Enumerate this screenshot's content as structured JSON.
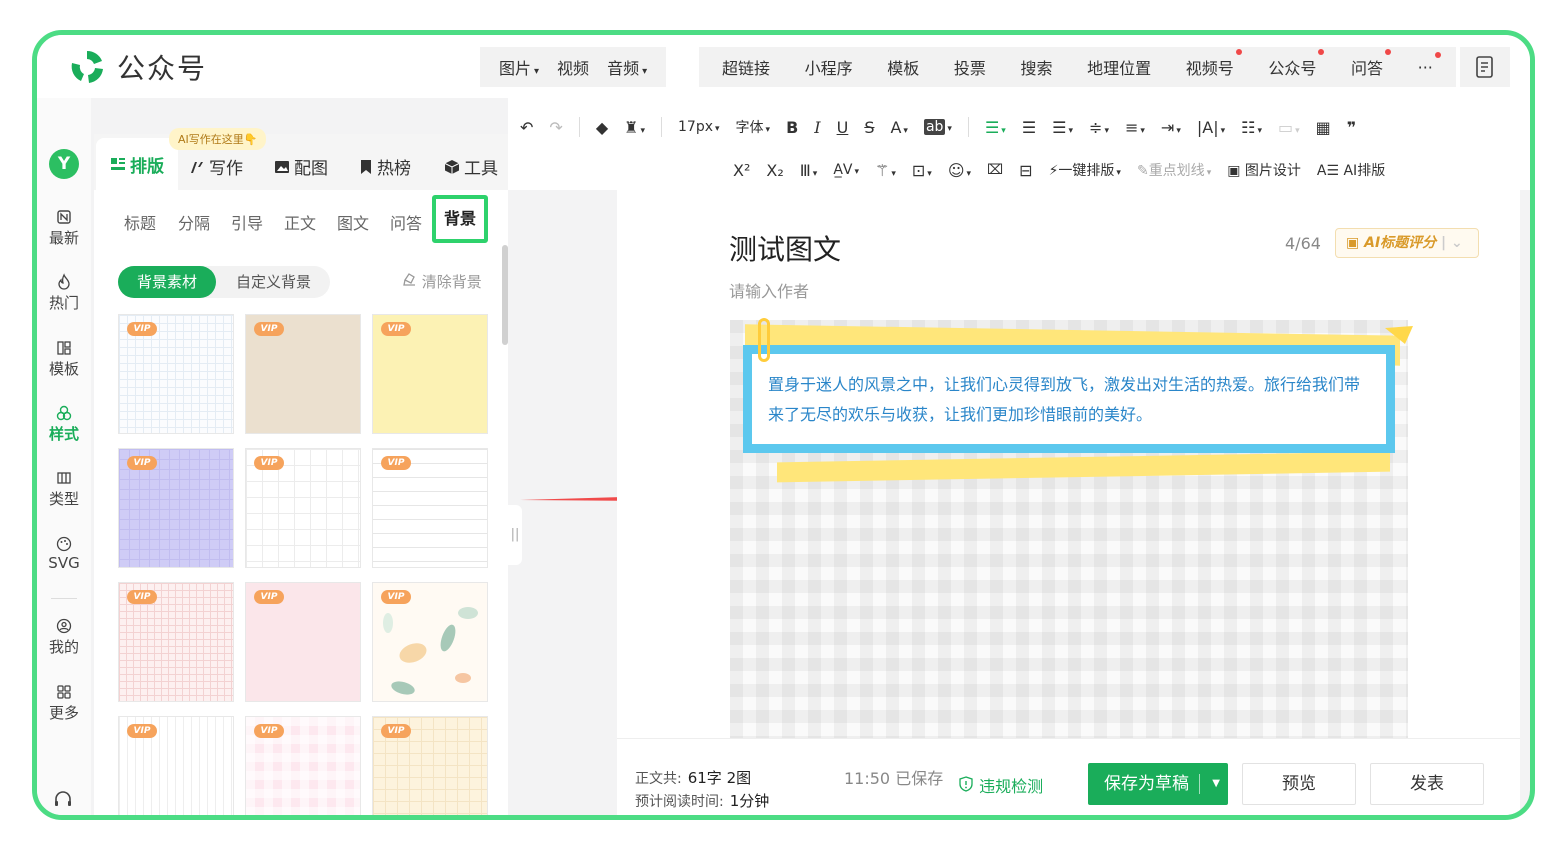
{
  "header": {
    "brand": "公众号",
    "media_items": [
      {
        "label": "图片",
        "caret": "▾"
      },
      {
        "label": "视频",
        "caret": ""
      },
      {
        "label": "音频",
        "caret": "▾"
      }
    ],
    "insert_items": [
      {
        "label": "超链接"
      },
      {
        "label": "小程序"
      },
      {
        "label": "模板"
      },
      {
        "label": "投票"
      },
      {
        "label": "搜索"
      },
      {
        "label": "地理位置"
      },
      {
        "label": "视频号"
      },
      {
        "label": "公众号"
      },
      {
        "label": "问答"
      },
      {
        "label": "···"
      }
    ]
  },
  "leftnav": {
    "logo": "Y",
    "items": [
      {
        "label": "最新"
      },
      {
        "label": "热门"
      },
      {
        "label": "模板"
      },
      {
        "label": "样式"
      },
      {
        "label": "类型"
      },
      {
        "label": "SVG"
      },
      {
        "label": "我的"
      },
      {
        "label": "更多"
      }
    ]
  },
  "panel": {
    "ai_badge": "AI写作在这里👇",
    "tabs": [
      {
        "label": "排版"
      },
      {
        "label": "写作"
      },
      {
        "label": "配图"
      },
      {
        "label": "热榜"
      },
      {
        "label": "工具"
      }
    ],
    "subtabs": [
      {
        "label": "标题"
      },
      {
        "label": "分隔"
      },
      {
        "label": "引导"
      },
      {
        "label": "正文"
      },
      {
        "label": "图文"
      },
      {
        "label": "问答"
      },
      {
        "label": "背景"
      }
    ],
    "segment_on": "背景素材",
    "segment_off": "自定义背景",
    "clear_bg": "清除背景",
    "vip_label": "VIP"
  },
  "toolbar": {
    "row1": {
      "font_size": "17px",
      "font_family": "字体",
      "bold": "B",
      "italic": "I",
      "underline": "U",
      "strike": "S",
      "color": "A",
      "highlight": "ab"
    },
    "row2": {
      "sup": "X²",
      "sub": "X₂",
      "one_click": "一键排版",
      "key_line": "重点划线",
      "pic_design": "图片设计",
      "ai_layout": "AI排版"
    }
  },
  "editor": {
    "title": "测试图文",
    "title_count": "4/64",
    "ai_score": "AI标题评分",
    "author_placeholder": "请输入作者",
    "quote_text": "置身于迷人的风景之中，让我们心灵得到放飞，激发出对生活的热爱。旅行给我们带来了无尽的欢乐与收获，让我们更加珍惜眼前的美好。"
  },
  "footer": {
    "stat_label": "正文共:",
    "stat_value": "61字 2图",
    "read_label": "预计阅读时间:",
    "read_value": "1分钟",
    "saved_time": "11:50  已保存",
    "check": "违规检测",
    "save_draft": "保存为草稿",
    "preview": "预览",
    "publish": "发表"
  },
  "colors": {
    "brand_green": "#1aad5a",
    "highlight_border": "#2ed26c",
    "frame": "#4cdc84",
    "arrow": "#f04a4a"
  }
}
